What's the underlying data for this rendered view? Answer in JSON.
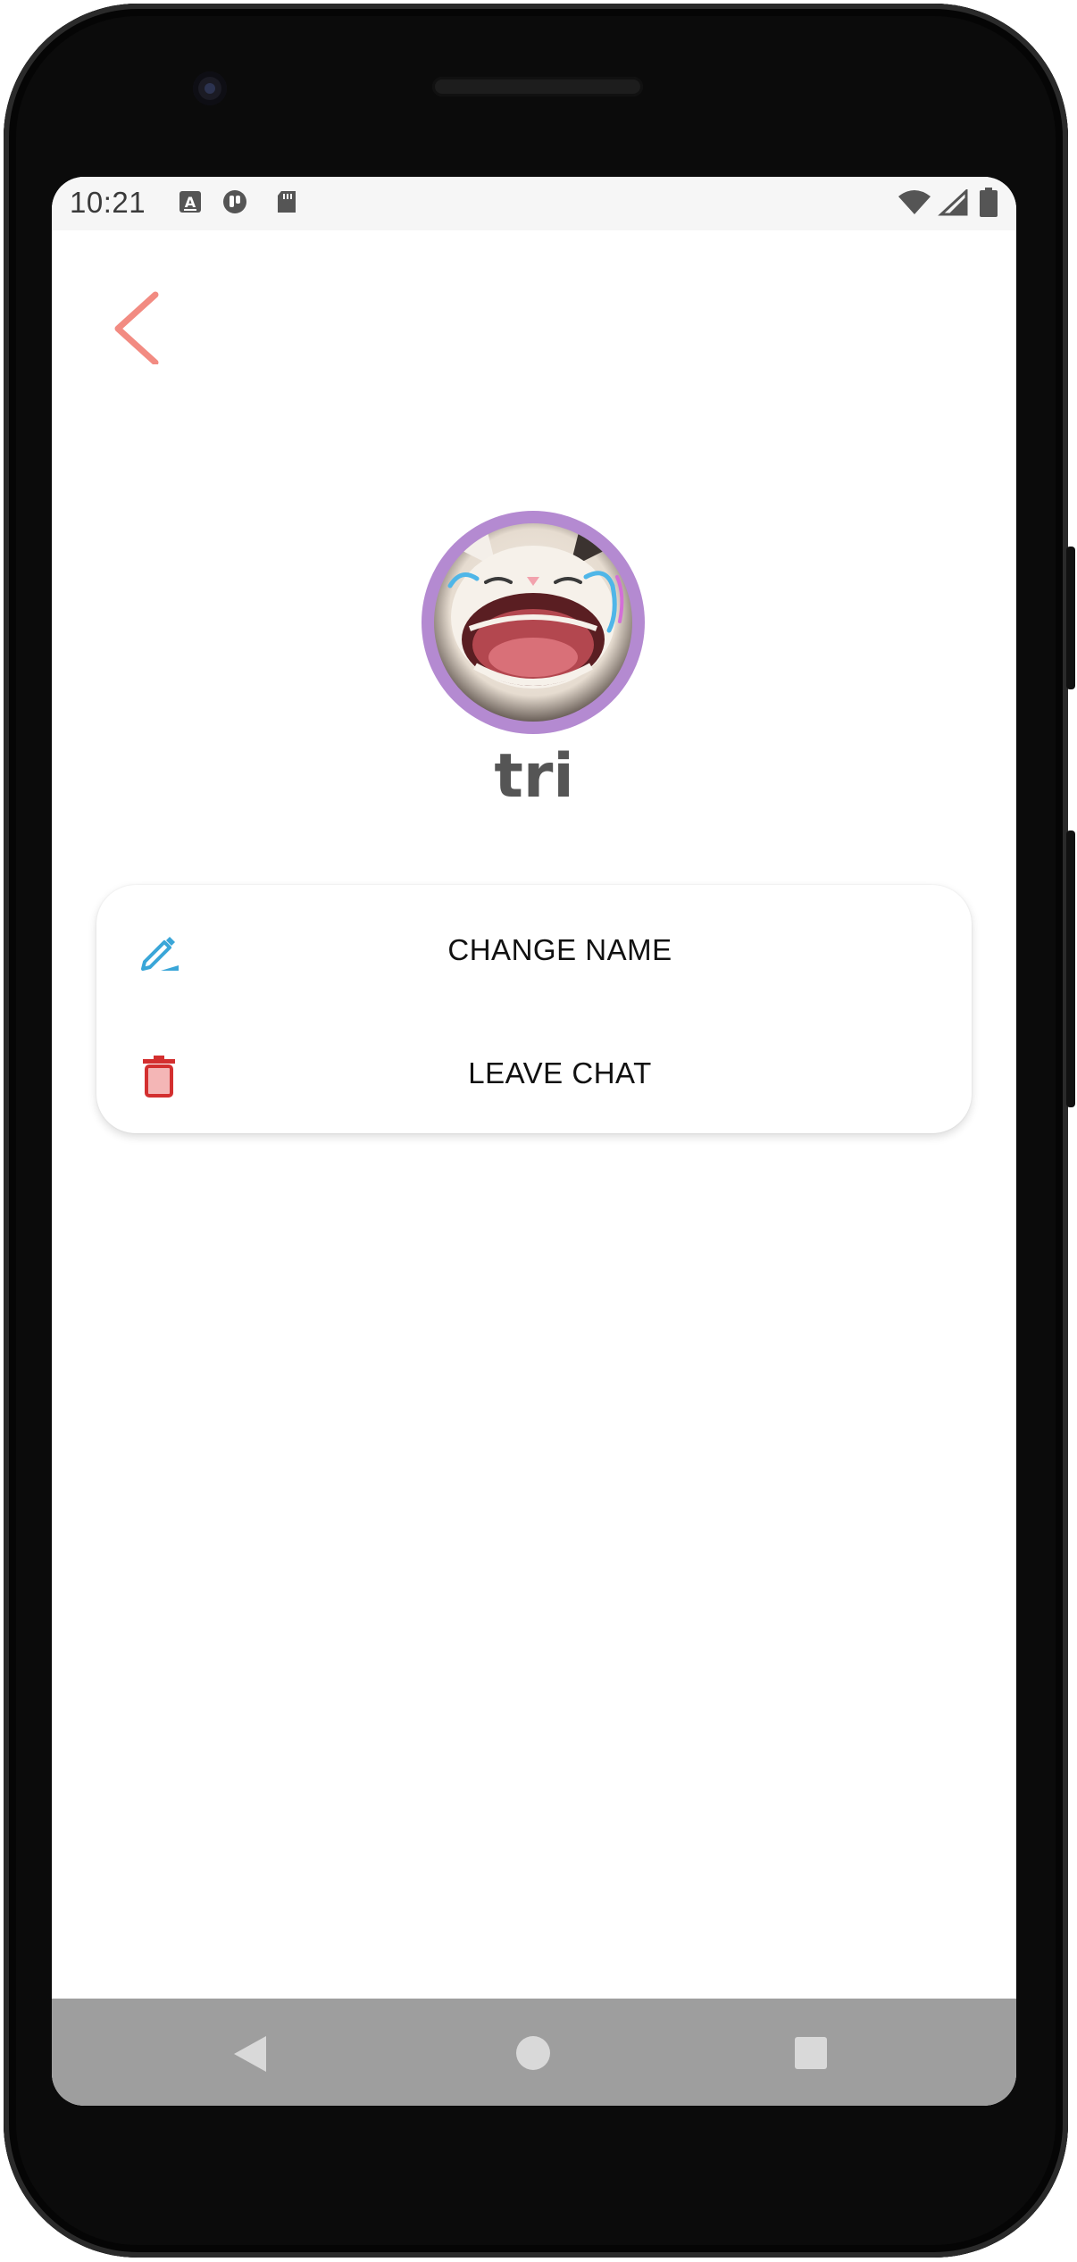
{
  "status_bar": {
    "time": "10:21",
    "icons": [
      "keyboard-a-icon",
      "circle-app-icon",
      "sd-card-icon",
      "wifi-icon",
      "cell-signal-icon",
      "battery-icon"
    ]
  },
  "header": {
    "back_icon": "chevron-left-icon",
    "accent_color": "#f28b82"
  },
  "profile": {
    "avatar_ring_color": "#b48ad1",
    "name": "tri"
  },
  "actions": [
    {
      "label": "CHANGE NAME",
      "icon": "edit-pencil-icon",
      "color": "#3aa6d8"
    },
    {
      "label": "LEAVE CHAT",
      "icon": "trash-icon",
      "color": "#d32f2f"
    }
  ],
  "nav_bar": {
    "buttons": [
      "nav-back-icon",
      "nav-home-icon",
      "nav-recents-icon"
    ]
  }
}
